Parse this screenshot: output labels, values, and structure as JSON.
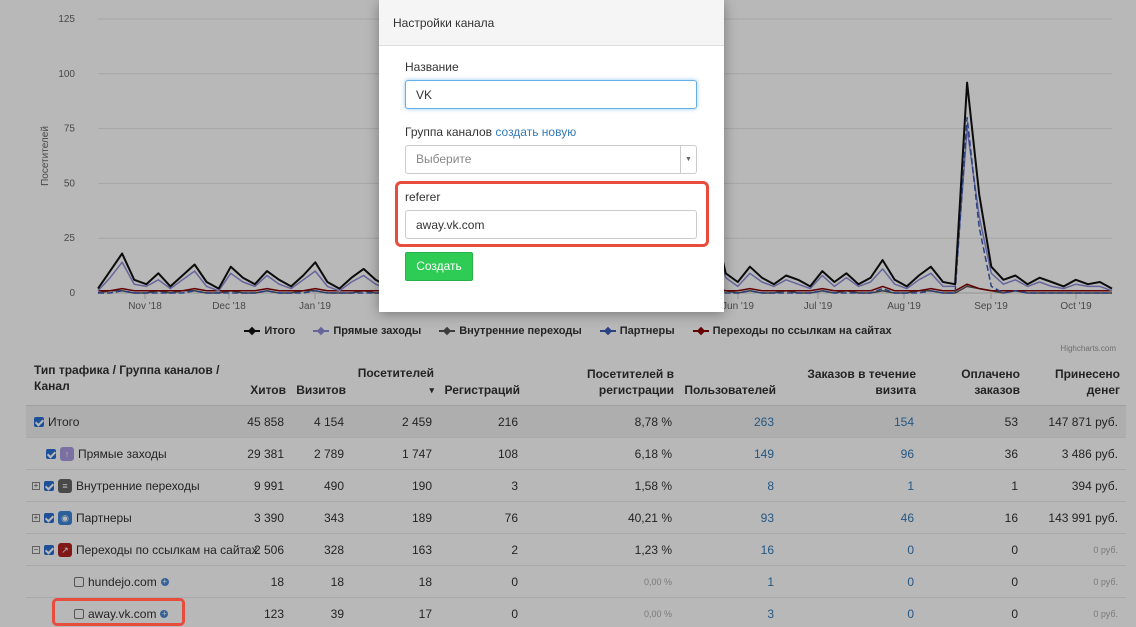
{
  "modal": {
    "title": "Настройки канала",
    "name_label": "Название",
    "name_value": "VK",
    "group_label": "Группа каналов",
    "group_create_link": "создать новую",
    "group_select_value": "Выберите",
    "referer_label": "referer",
    "referer_value": "away.vk.com",
    "create_button": "Создать"
  },
  "chart_data": {
    "type": "line",
    "ylabel": "Посетителей",
    "ylim": [
      0,
      125
    ],
    "yticks": [
      "0",
      "25",
      "50",
      "75",
      "100",
      "125"
    ],
    "xticks": [
      "Nov '18",
      "Dec '18",
      "Jan '19",
      "Jun '19",
      "Jul '19",
      "Aug '19",
      "Sep '19",
      "Oct '19"
    ],
    "grid": true,
    "legend_position": "bottom",
    "credits": "Highcharts.com",
    "series": [
      {
        "name": "Итого",
        "color": "#111111",
        "marker": "diamond",
        "values": [
          2,
          10,
          18,
          6,
          4,
          9,
          3,
          8,
          13,
          5,
          2,
          12,
          7,
          4,
          10,
          6,
          3,
          8,
          14,
          5,
          2,
          7,
          11,
          6,
          3,
          9,
          5,
          4,
          8,
          12,
          6,
          3,
          26,
          9,
          5,
          7,
          4,
          8,
          3,
          6,
          10,
          5,
          4,
          9,
          6,
          3,
          11,
          5,
          8,
          4,
          7,
          33,
          9,
          5,
          12,
          7,
          4,
          8,
          6,
          3,
          10,
          5,
          9,
          4,
          7,
          15,
          6,
          3,
          8,
          12,
          5,
          4,
          96,
          45,
          12,
          6,
          8,
          4,
          7,
          5,
          3,
          6,
          4,
          5,
          2
        ]
      },
      {
        "name": "Прямые заходы",
        "color": "#8c8cd9",
        "marker": "diamond",
        "values": [
          1,
          7,
          14,
          4,
          3,
          6,
          2,
          6,
          10,
          3,
          1,
          9,
          5,
          3,
          8,
          4,
          2,
          6,
          10,
          3,
          1,
          5,
          8,
          4,
          2,
          7,
          3,
          3,
          6,
          9,
          4,
          2,
          20,
          7,
          3,
          5,
          3,
          6,
          2,
          4,
          8,
          3,
          3,
          7,
          4,
          2,
          8,
          3,
          6,
          3,
          5,
          25,
          7,
          3,
          9,
          5,
          3,
          6,
          4,
          2,
          8,
          3,
          7,
          3,
          5,
          11,
          4,
          2,
          6,
          9,
          3,
          3,
          75,
          35,
          9,
          4,
          6,
          3,
          5,
          3,
          2,
          4,
          3,
          3,
          1
        ]
      },
      {
        "name": "Внутренние переходы",
        "color": "#555555",
        "marker": "diamond",
        "values": [
          0,
          1,
          1,
          0,
          0,
          1,
          0,
          1,
          1,
          0,
          0,
          1,
          0,
          0,
          1,
          0,
          0,
          1,
          1,
          0,
          0,
          0,
          1,
          0,
          0,
          1,
          0,
          0,
          1,
          1,
          0,
          0,
          2,
          1,
          0,
          0,
          0,
          1,
          0,
          0,
          1,
          0,
          0,
          1,
          0,
          0,
          1,
          0,
          1,
          0,
          0,
          2,
          1,
          0,
          1,
          0,
          0,
          1,
          0,
          0,
          1,
          0,
          1,
          0,
          0,
          1,
          0,
          0,
          1,
          1,
          0,
          0,
          3,
          2,
          1,
          0,
          1,
          0,
          0,
          0,
          0,
          0,
          0,
          0,
          0
        ]
      },
      {
        "name": "Партнеры",
        "color": "#3b5bb5",
        "marker": "triangle",
        "values": [
          0,
          0,
          1,
          0,
          0,
          0,
          0,
          0,
          1,
          0,
          0,
          0,
          0,
          0,
          1,
          0,
          0,
          0,
          1,
          0,
          0,
          0,
          0,
          0,
          0,
          0,
          0,
          0,
          0,
          1,
          0,
          0,
          1,
          0,
          0,
          0,
          0,
          0,
          0,
          0,
          1,
          0,
          0,
          0,
          0,
          0,
          1,
          0,
          0,
          0,
          0,
          1,
          0,
          0,
          1,
          0,
          0,
          0,
          0,
          0,
          1,
          0,
          0,
          0,
          0,
          2,
          0,
          0,
          0,
          1,
          0,
          0,
          80,
          30,
          3,
          0,
          1,
          0,
          0,
          0,
          0,
          0,
          0,
          0,
          0
        ]
      },
      {
        "name": "Переходы по ссылкам на сайтах",
        "color": "#8b0000",
        "marker": "triangle-down",
        "values": [
          1,
          1,
          2,
          1,
          1,
          1,
          1,
          1,
          2,
          1,
          1,
          1,
          1,
          1,
          2,
          1,
          1,
          1,
          2,
          1,
          1,
          1,
          1,
          1,
          1,
          1,
          1,
          1,
          1,
          2,
          1,
          1,
          3,
          1,
          1,
          1,
          1,
          1,
          1,
          1,
          2,
          1,
          1,
          1,
          1,
          1,
          2,
          1,
          1,
          1,
          1,
          2,
          1,
          1,
          2,
          1,
          1,
          1,
          1,
          1,
          2,
          1,
          1,
          1,
          1,
          3,
          1,
          1,
          1,
          2,
          1,
          1,
          4,
          2,
          1,
          1,
          1,
          1,
          1,
          1,
          1,
          1,
          1,
          1,
          1
        ]
      }
    ]
  },
  "table": {
    "headers": [
      "Тип трафика / Группа каналов / Канал",
      "Хитов",
      "Визитов",
      "Посетителей",
      "Регистраций",
      "Посетителей в регистрации",
      "Пользователей",
      "Заказов в течение визита",
      "Оплачено заказов",
      "Принесено денег"
    ],
    "sort_indicator": "▾",
    "rows": [
      {
        "name": "Итого",
        "vals": [
          "45 858",
          "4 154",
          "2 459",
          "216",
          "8,78 %",
          "263",
          "154",
          "53",
          "147 871 руб."
        ]
      },
      {
        "name": "Прямые заходы",
        "vals": [
          "29 381",
          "2 789",
          "1 747",
          "108",
          "6,18 %",
          "149",
          "96",
          "36",
          "3 486 руб."
        ]
      },
      {
        "name": "Внутренние переходы",
        "vals": [
          "9 991",
          "490",
          "190",
          "3",
          "1,58 %",
          "8",
          "1",
          "1",
          "394 руб."
        ]
      },
      {
        "name": "Партнеры",
        "vals": [
          "3 390",
          "343",
          "189",
          "76",
          "40,21 %",
          "93",
          "46",
          "16",
          "143 991 руб."
        ]
      },
      {
        "name": "Переходы по ссылкам на сайтах",
        "vals": [
          "2 506",
          "328",
          "163",
          "2",
          "1,23 %",
          "16",
          "0",
          "0",
          "0 руб."
        ]
      },
      {
        "name": "hundejo.com",
        "vals": [
          "18",
          "18",
          "18",
          "0",
          "0,00 %",
          "1",
          "0",
          "0",
          "0 руб."
        ]
      },
      {
        "name": "away.vk.com",
        "vals": [
          "123",
          "39",
          "17",
          "0",
          "0,00 %",
          "3",
          "0",
          "0",
          "0 руб."
        ]
      }
    ]
  }
}
